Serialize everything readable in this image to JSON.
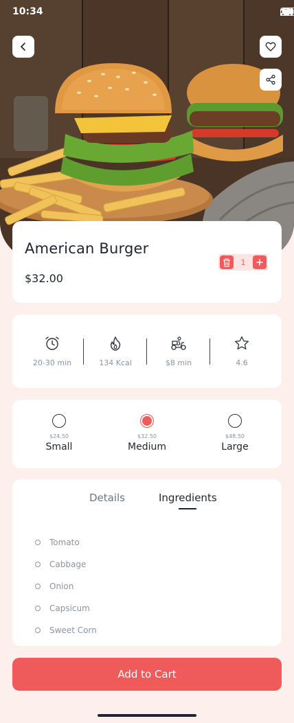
{
  "status_bar": {
    "time": "10:34"
  },
  "product": {
    "name": "American Burger",
    "price": "$32.00",
    "quantity": "1"
  },
  "info": [
    {
      "icon": "alarm-clock-icon",
      "label": "20-30 min"
    },
    {
      "icon": "flame-icon",
      "label": "134 Kcal"
    },
    {
      "icon": "delivery-scooter-icon",
      "label": "$8 min"
    },
    {
      "icon": "star-icon",
      "label": "4.6"
    }
  ],
  "sizes": [
    {
      "price": "$24.50",
      "name": "Small",
      "selected": false
    },
    {
      "price": "$32.50",
      "name": "Medium",
      "selected": true
    },
    {
      "price": "$48.50",
      "name": "Large",
      "selected": false
    }
  ],
  "tabs": {
    "details": "Details",
    "ingredients": "Ingredients",
    "active": "ingredients"
  },
  "ingredients": [
    "Tomato",
    "Cabbage",
    "Onion",
    "Capsicum",
    "Sweet Corn"
  ],
  "cart": {
    "label": "Add to Cart"
  },
  "colors": {
    "accent": "#ef5a5a",
    "background": "#fdf0ec",
    "accent_soft": "#fde4e2"
  }
}
